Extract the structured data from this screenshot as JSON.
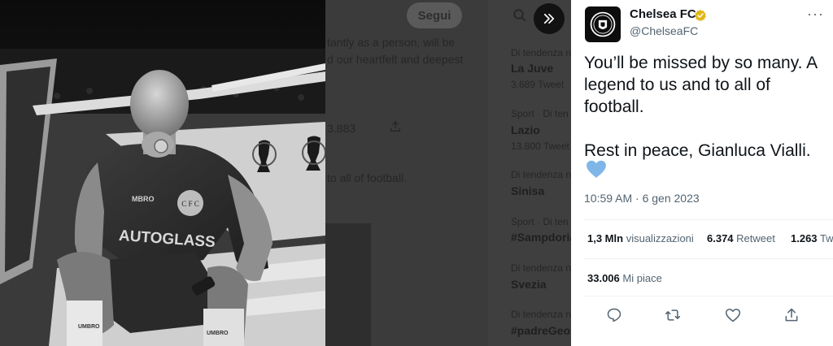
{
  "background_timeline": {
    "follow_button": "Segui",
    "text_line_1": "tantly as a person, will be",
    "text_line_2": "d our heartfelt and deepest",
    "stat_count": "3.883",
    "text_line_3": "to all of football.",
    "trends": [
      {
        "meta": "Di tendenza n",
        "name": "La Juve",
        "count": "3.689 Tweet"
      },
      {
        "meta": "Sport · Di ten",
        "name": "Lazio",
        "count": "13.800 Tweet"
      },
      {
        "meta": "Di tendenza n",
        "name": "Sinisa",
        "count": ""
      },
      {
        "meta": "Sport · Di ten",
        "name": "#Sampdoria",
        "count": ""
      },
      {
        "meta": "Di tendenza n",
        "name": "Svezia",
        "count": ""
      },
      {
        "meta": "Di tendenza n",
        "name": "#padreGeo",
        "count": ""
      }
    ]
  },
  "photo": {
    "shirt_sponsor": "AUTOGLASS",
    "kit_brand": "UMBRO",
    "kit_brand_short": "MBRO",
    "crest_letters": "C F C"
  },
  "tweet": {
    "author": {
      "name": "Chelsea FC",
      "handle": "@ChelseaFC",
      "avatar_icon": "chelsea-crest-icon",
      "verified_color": "#e2b719"
    },
    "text": "You’ll be missed by so many. A legend to us and to all of football.\n\nRest in peace, Gianluca Vialli.",
    "emoji": "blue-heart",
    "emoji_color": "#7fb6e8",
    "timestamp": "10:59 AM · 6 gen 2023",
    "stats": {
      "views_value": "1,3 Mln",
      "views_label": "visualizzazioni",
      "retweets_value": "6.374",
      "retweets_label": "Retweet",
      "quotes_value": "1.263",
      "quotes_label": "Tw",
      "likes_value": "33.006",
      "likes_label": "Mi piace"
    },
    "actions": [
      "reply-icon",
      "retweet-icon",
      "like-icon",
      "share-icon"
    ]
  },
  "colors": {
    "text_primary": "#0f1419",
    "text_secondary": "#536471",
    "overlay_dim": "#3b3b3b"
  }
}
